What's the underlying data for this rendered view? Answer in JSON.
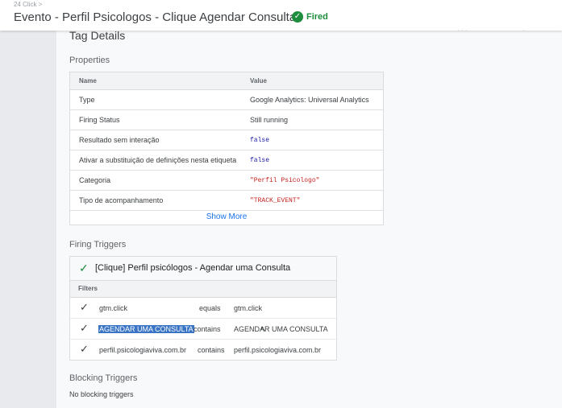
{
  "header": {
    "breadcrumb": "24 Click >",
    "title": "Evento - Perfil Psicologos - Clique Agendar Consulta",
    "status": "Fired",
    "status_color": "#1e8e3e"
  },
  "tag_details": {
    "title": "Tag Details",
    "properties_heading": "Properties",
    "columns": {
      "name": "Name",
      "value": "Value"
    },
    "rows": [
      {
        "name": "Type",
        "value": "Google Analytics: Universal Analytics"
      },
      {
        "name": "Firing Status",
        "value": "Still running"
      },
      {
        "name": "Resultado sem interação",
        "value": "false"
      },
      {
        "name": "Ativar a substituição de definições nesta etiqueta",
        "value": "false"
      },
      {
        "name": "Categoria",
        "value": "\"Perfil Psicologo\""
      },
      {
        "name": "Tipo de acompanhamento",
        "value": "\"TRACK_EVENT\""
      }
    ],
    "show_more": "Show More"
  },
  "firing_triggers": {
    "heading": "Firing Triggers",
    "trigger_name": "[Clique] Perfil psicólogos - Agendar uma Consulta",
    "filters_heading": "Filters",
    "filters": [
      {
        "variable": "gtm.click",
        "operator": "equals",
        "value": "gtm.click"
      },
      {
        "variable": "AGENDAR UMA CONSULTA",
        "operator": "contains",
        "value": "AGENDAR UMA CONSULTA"
      },
      {
        "variable": "perfil.psicologiaviva.com.br",
        "operator": "contains",
        "value": "perfil.psicologiaviva.com.br"
      }
    ]
  },
  "blocking_triggers": {
    "heading": "Blocking Triggers",
    "empty_text": "No blocking triggers"
  }
}
